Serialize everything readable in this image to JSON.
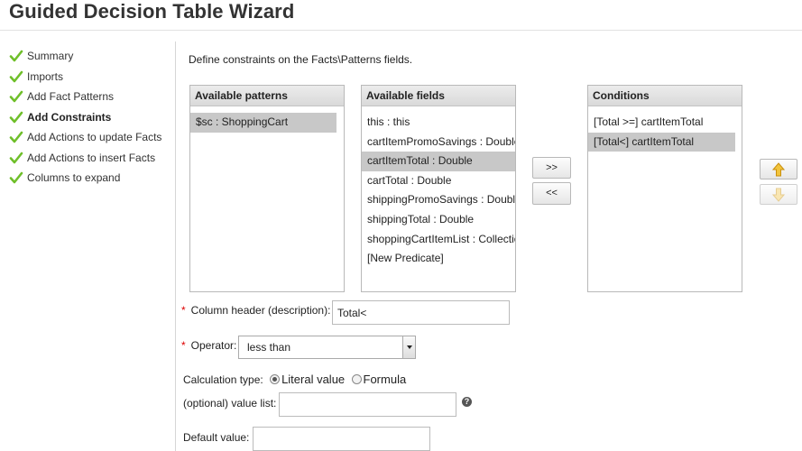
{
  "header": {
    "title": "Guided Decision Table Wizard"
  },
  "steps": [
    {
      "label": "Summary",
      "active": false
    },
    {
      "label": "Imports",
      "active": false
    },
    {
      "label": "Add Fact Patterns",
      "active": false
    },
    {
      "label": "Add Constraints",
      "active": true
    },
    {
      "label": "Add Actions to update Facts",
      "active": false
    },
    {
      "label": "Add Actions to insert Facts",
      "active": false
    },
    {
      "label": "Columns to expand",
      "active": false
    }
  ],
  "main": {
    "intro": "Define constraints on the Facts\\Patterns fields.",
    "patterns_panel": {
      "header": "Available patterns",
      "items": [
        {
          "label": "$sc : ShoppingCart",
          "selected": true
        }
      ]
    },
    "fields_panel": {
      "header": "Available fields",
      "items": [
        {
          "label": "this : this",
          "selected": false
        },
        {
          "label": "cartItemPromoSavings : Double",
          "selected": false
        },
        {
          "label": "cartItemTotal : Double",
          "selected": true
        },
        {
          "label": "cartTotal : Double",
          "selected": false
        },
        {
          "label": "shippingPromoSavings : Double",
          "selected": false
        },
        {
          "label": "shippingTotal : Double",
          "selected": false
        },
        {
          "label": "shoppingCartItemList : Collection",
          "selected": false
        },
        {
          "label": "[New Predicate]",
          "selected": false
        }
      ]
    },
    "conditions_panel": {
      "header": "Conditions",
      "items": [
        {
          "label": "[Total >=] cartItemTotal",
          "selected": false
        },
        {
          "label": "[Total<] cartItemTotal",
          "selected": true
        }
      ]
    },
    "buttons": {
      "add": ">>",
      "remove": "<<"
    },
    "form": {
      "required_marker": "*",
      "column_header_label": "Column header (description):",
      "column_header_value": "Total<",
      "operator_label": "Operator:",
      "operator_value": "less than",
      "calc_type_label": "Calculation type:",
      "calc_literal": "Literal value",
      "calc_formula": "Formula",
      "calc_selected": "Literal value",
      "value_list_label": "(optional) value list:",
      "value_list_value": "",
      "default_value_label": "Default value:",
      "default_value_value": "",
      "help_glyph": "?"
    }
  },
  "colors": {
    "check": "#6fbf2a",
    "arrow": "#e9b21d",
    "selection": "#c8c8c8"
  }
}
